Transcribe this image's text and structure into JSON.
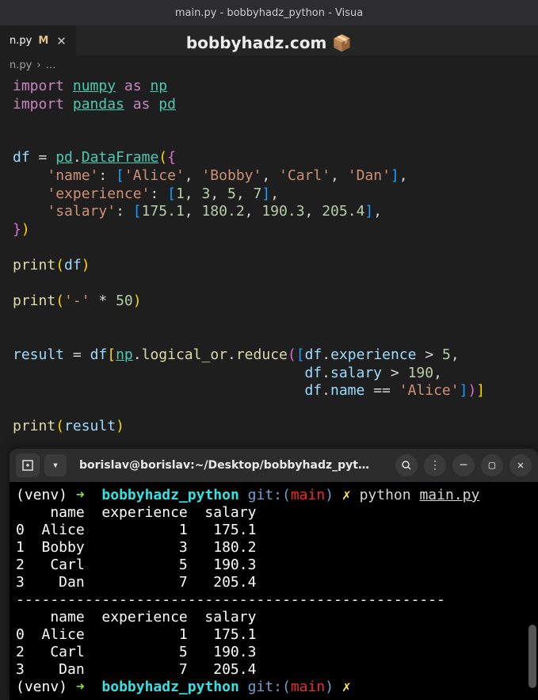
{
  "window_title": "main.py - bobbyhadz_python - Visua",
  "watermark": "bobbyhadz.com 📦",
  "tab": {
    "name": "n.py",
    "git_status": "M"
  },
  "breadcrumb": {
    "file": "n.py",
    "sep": "›",
    "more": "…"
  },
  "code": {
    "l1": {
      "import": "import",
      "mod": "numpy",
      "as": "as",
      "alias": "np"
    },
    "l2": {
      "import": "import",
      "mod": "pandas",
      "as": "as",
      "alias": "pd"
    },
    "l3": {
      "var": "df",
      "eq": "=",
      "pd": "pd",
      "cls": "DataFrame"
    },
    "l4": {
      "key": "'name'",
      "v1": "'Alice'",
      "v2": "'Bobby'",
      "v3": "'Carl'",
      "v4": "'Dan'"
    },
    "l5": {
      "key": "'experience'",
      "v1": "1",
      "v2": "3",
      "v3": "5",
      "v4": "7"
    },
    "l6": {
      "key": "'salary'",
      "v1": "175.1",
      "v2": "180.2",
      "v3": "190.3",
      "v4": "205.4"
    },
    "l7": {
      "fn": "print",
      "arg": "df"
    },
    "l8": {
      "fn": "print",
      "str": "'-'",
      "op": "*",
      "num": "50"
    },
    "l9": {
      "var": "result",
      "eq": "=",
      "df": "df",
      "np": "np",
      "fn1": "logical_or",
      "fn2": "reduce",
      "e1_attr": "experience",
      "e1_cmp": ">",
      "e1_val": "5"
    },
    "l10": {
      "attr": "salary",
      "cmp": ">",
      "val": "190"
    },
    "l11": {
      "attr": "name",
      "cmp": "==",
      "val": "'Alice'"
    },
    "l12": {
      "fn": "print",
      "arg": "result"
    }
  },
  "terminal": {
    "title": "borislav@borislav:~/Desktop/bobbyhadz_pyt…",
    "venv": "(venv)",
    "arrow": "➜",
    "dir": "bobbyhadz_python",
    "git": "git:(",
    "branch": "main",
    "gitclose": ")",
    "x": "✗",
    "cmd": "python",
    "file": "main.py",
    "out1_hdr": "    name  experience  salary",
    "out1_r0": "0  Alice           1   175.1",
    "out1_r1": "1  Bobby           3   180.2",
    "out1_r2": "2   Carl           5   190.3",
    "out1_r3": "3    Dan           7   205.4",
    "sep": "--------------------------------------------------",
    "out2_hdr": "    name  experience  salary",
    "out2_r0": "0  Alice           1   175.1",
    "out2_r1": "2   Carl           5   190.3",
    "out2_r2": "3    Dan           7   205.4"
  }
}
